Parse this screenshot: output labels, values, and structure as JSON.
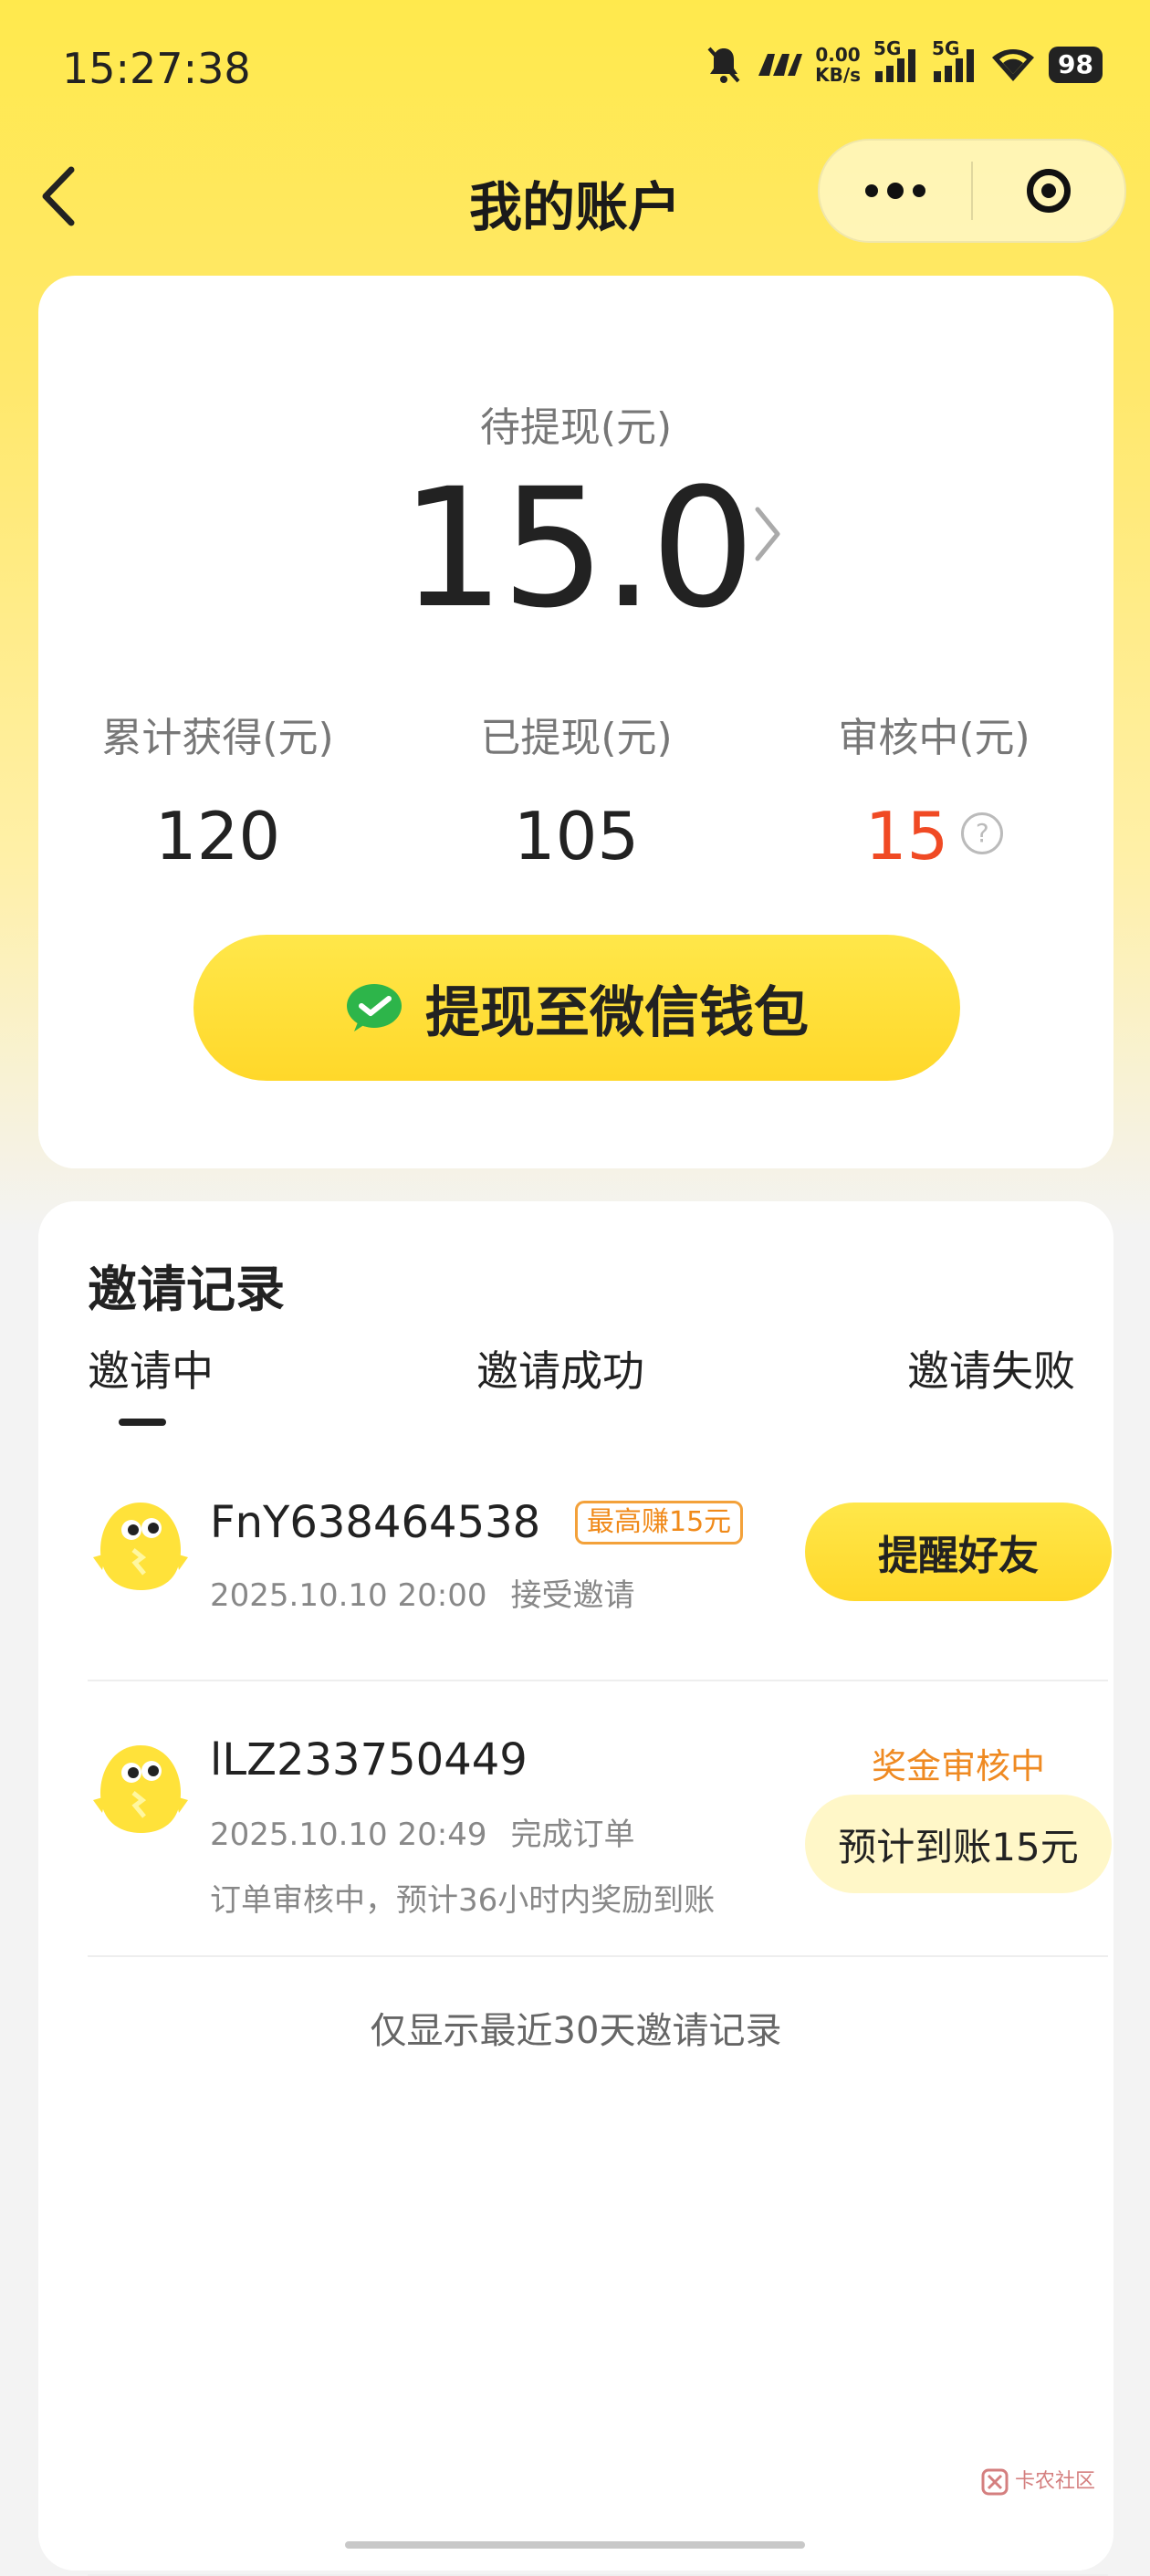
{
  "status_bar": {
    "time": "15:27:38",
    "net_speed_top": "0.00",
    "net_speed_bottom": "KB/s",
    "sim1": "5G",
    "sim2": "5G",
    "battery": "98"
  },
  "nav": {
    "title": "我的账户"
  },
  "account": {
    "pending_label": "待提现(元)",
    "pending_amount": "15.0",
    "stats": [
      {
        "label": "累计获得(元)",
        "value": "120"
      },
      {
        "label": "已提现(元)",
        "value": "105"
      },
      {
        "label": "审核中(元)",
        "value": "15"
      }
    ],
    "withdraw_label": "提现至微信钱包"
  },
  "invites": {
    "title": "邀请记录",
    "tabs": [
      "邀请中",
      "邀请成功",
      "邀请失败"
    ],
    "active_tab": "邀请中",
    "records": [
      {
        "user": "FnY638464538",
        "tag": "最高赚15元",
        "date": "2025.10.10 20:00",
        "event": "接受邀请",
        "action_label": "提醒好友"
      },
      {
        "user": "lLZ233750449",
        "date": "2025.10.10 20:49",
        "event": "完成订单",
        "note": "订单审核中，预计36小时内奖励到账",
        "status": "奖金审核中",
        "pill": "预计到账15元"
      }
    ],
    "footer": "仅显示最近30天邀请记录"
  },
  "watermark": "卡农社区",
  "colors": {
    "accent": "#ffe13a",
    "highlight_red": "#f04a24",
    "orange": "#ef8a22"
  }
}
